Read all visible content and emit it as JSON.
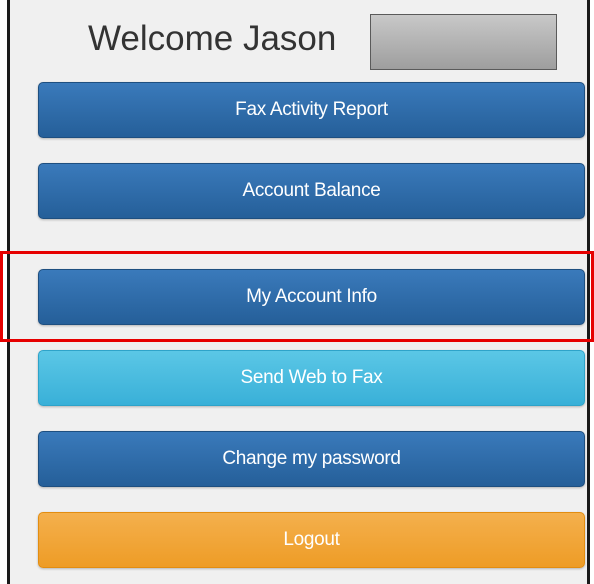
{
  "welcome": {
    "text": "Welcome Jason"
  },
  "menu": {
    "fax_activity_report": "Fax Activity Report",
    "account_balance": "Account Balance",
    "my_account_info": "My Account Info",
    "send_web_to_fax": "Send Web to Fax",
    "change_my_password": "Change my password",
    "logout": "Logout"
  },
  "colors": {
    "primary": "#2d6ca9",
    "info": "#46bbe0",
    "warning": "#f0a53a",
    "highlight": "#e60000"
  }
}
